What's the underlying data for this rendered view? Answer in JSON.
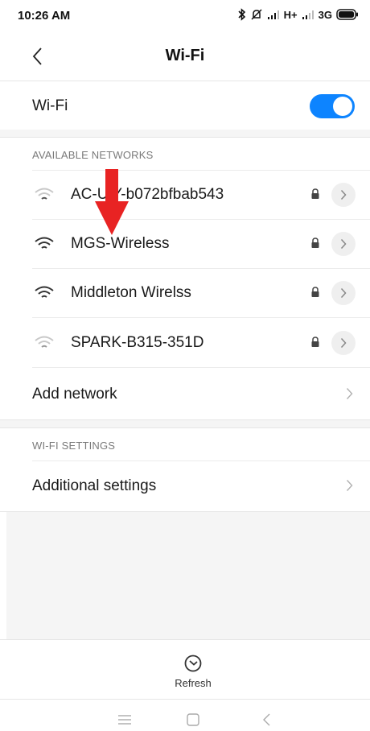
{
  "status_bar": {
    "time": "10:26 AM",
    "network_type_1": "H+",
    "network_type_2": "3G",
    "icons": [
      "bluetooth-icon",
      "mute-icon",
      "signal-icon",
      "signal-icon",
      "battery-icon"
    ]
  },
  "header": {
    "title": "Wi-Fi",
    "back_icon": "chevron-left-icon"
  },
  "wifi_toggle": {
    "label": "Wi-Fi",
    "enabled": true,
    "accent_color": "#0d84ff"
  },
  "available_networks": {
    "section_label": "AVAILABLE NETWORKS",
    "items": [
      {
        "name": "AC-U  Y-b072bfbab543",
        "signal": "weak",
        "secured": true
      },
      {
        "name": "MGS-Wireless",
        "signal": "strong",
        "secured": true
      },
      {
        "name": "Middleton Wirelss",
        "signal": "strong",
        "secured": true
      },
      {
        "name": "SPARK-B315-351D",
        "signal": "weak",
        "secured": true
      }
    ],
    "add_network_label": "Add network"
  },
  "wifi_settings": {
    "section_label": "WI-FI SETTINGS",
    "additional_label": "Additional settings"
  },
  "refresh": {
    "label": "Refresh",
    "icon": "refresh-icon"
  },
  "nav_bar": {
    "icons": [
      "menu-icon",
      "home-icon",
      "back-icon"
    ]
  },
  "annotation": {
    "color": "#e82323",
    "icon": "arrow-down-icon"
  }
}
